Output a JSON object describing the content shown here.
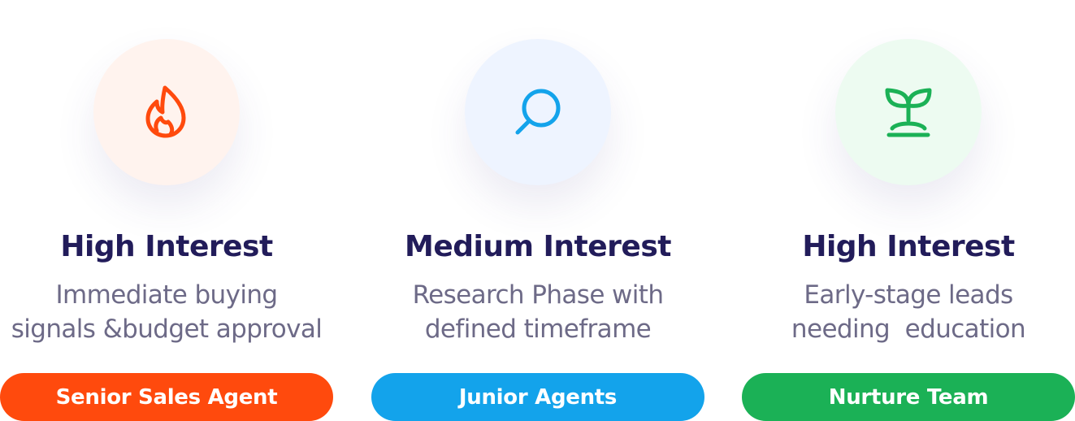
{
  "cards": [
    {
      "icon": "flame-icon",
      "title": "High Interest",
      "description_lines": [
        "Immediate buying",
        "signals &budget approval"
      ],
      "button_label": "Senior Sales Agent",
      "accent_color": "#ff4a0d",
      "circle_color": "#fff3ee"
    },
    {
      "icon": "search-icon",
      "title": "Medium Interest",
      "description_lines": [
        "Research Phase with",
        "defined timeframe"
      ],
      "button_label": "Junior Agents",
      "accent_color": "#13a3eb",
      "circle_color": "#eef4ff"
    },
    {
      "icon": "sprout-icon",
      "title": "High Interest",
      "description_lines": [
        "Early-stage leads",
        "needing  education"
      ],
      "button_label": "Nurture Team",
      "accent_color": "#1bb156",
      "circle_color": "#edfbf1"
    }
  ]
}
